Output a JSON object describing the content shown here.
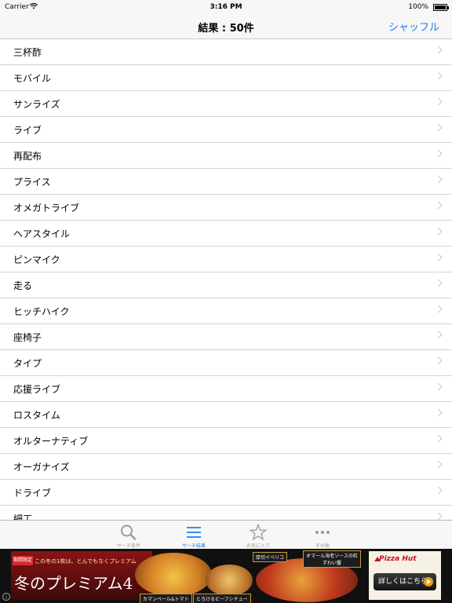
{
  "status_bar": {
    "carrier": "Carrier",
    "time": "3:16 PM",
    "battery": "100%"
  },
  "nav": {
    "title": "結果 : 50件",
    "shuffle_label": "シャッフル"
  },
  "results": [
    "三杯酢",
    "モバイル",
    "サンライズ",
    "ライブ",
    "再配布",
    "プライス",
    "オメガトライブ",
    "ヘアスタイル",
    "ピンマイク",
    "走る",
    "ヒッチハイク",
    "座椅子",
    "タイプ",
    "応援ライブ",
    "ロスタイム",
    "オルターナティブ",
    "オーガナイズ",
    "ドライブ",
    "細工"
  ],
  "tabs": [
    {
      "label": "サーチ条件",
      "icon": "search-icon"
    },
    {
      "label": "サーチ結果",
      "icon": "list-icon"
    },
    {
      "label": "お気に入り",
      "icon": "star-icon"
    },
    {
      "label": "その他",
      "icon": "more-icon"
    }
  ],
  "active_tab": "サーチ結果",
  "accent_color": "#1a7cf0",
  "ad": {
    "limited": "期間限定",
    "catch": "この冬の1枚は、とんでもなくプレミアム",
    "headline": "冬のプレミアム4",
    "tag_1": "カマンベール&トマト",
    "tag_2": "とろけるビーフシチュー",
    "tag_3": "厚切イベリコ",
    "tag_4": "オマール海老ソースの紅ずわい蟹",
    "brand": "Pizza Hut",
    "cta": "詳しくはこちら",
    "info": "i"
  }
}
